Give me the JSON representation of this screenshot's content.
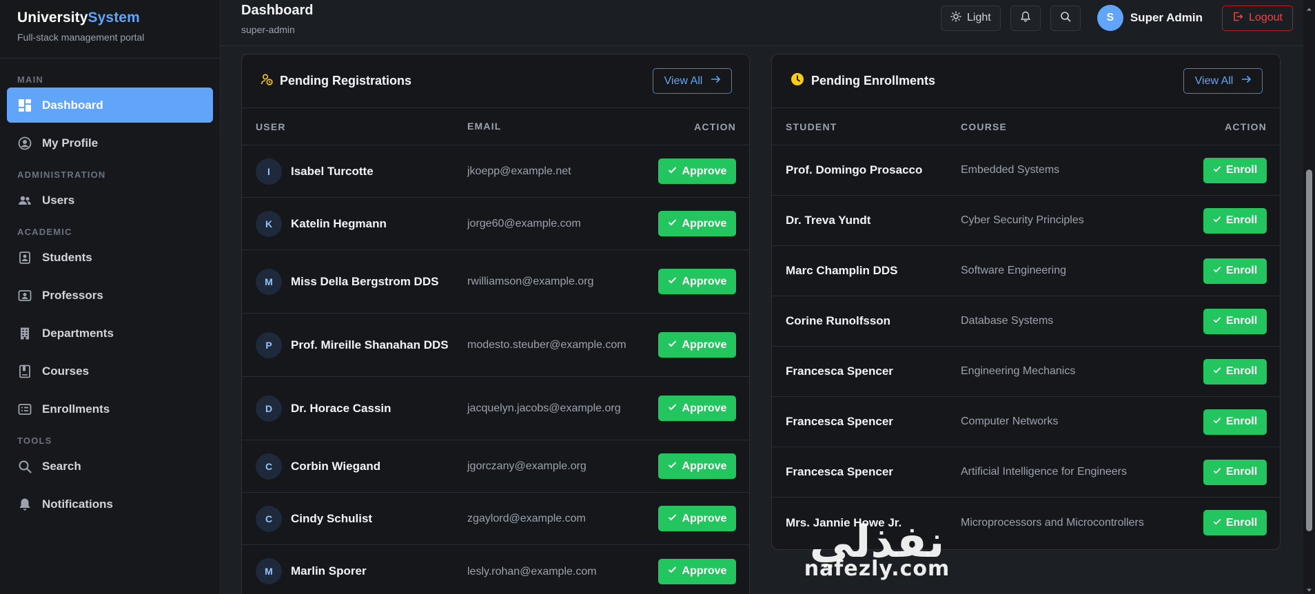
{
  "brand": {
    "title_main": "University",
    "title_accent": "System",
    "subtitle": "Full-stack management portal"
  },
  "sidebar": {
    "sections": [
      {
        "label": "MAIN",
        "items": [
          {
            "label": "Dashboard",
            "icon": "dashboard-icon",
            "active": true
          },
          {
            "label": "My Profile",
            "icon": "profile-icon"
          }
        ]
      },
      {
        "label": "ADMINISTRATION",
        "items": [
          {
            "label": "Users",
            "icon": "users-icon"
          }
        ]
      },
      {
        "label": "ACADEMIC",
        "items": [
          {
            "label": "Students",
            "icon": "students-icon"
          },
          {
            "label": "Professors",
            "icon": "professors-icon"
          },
          {
            "label": "Departments",
            "icon": "building-icon"
          },
          {
            "label": "Courses",
            "icon": "book-icon"
          },
          {
            "label": "Enrollments",
            "icon": "enrollment-icon"
          }
        ]
      },
      {
        "label": "TOOLS",
        "items": [
          {
            "label": "Search",
            "icon": "search-icon"
          },
          {
            "label": "Notifications",
            "icon": "bell-icon"
          }
        ]
      }
    ]
  },
  "header": {
    "title": "Dashboard",
    "subtitle": "super-admin",
    "theme_label": "Light",
    "user_initial": "S",
    "user_name": "Super Admin",
    "logout_label": "Logout"
  },
  "registrations": {
    "title": "Pending Registrations",
    "view_all": "View All",
    "columns": [
      "USER",
      "EMAIL",
      "ACTION"
    ],
    "approve_label": "Approve",
    "rows": [
      {
        "initial": "I",
        "name": "Isabel Turcotte",
        "email": "jkoepp@example.net"
      },
      {
        "initial": "K",
        "name": "Katelin Hegmann",
        "email": "jorge60@example.com"
      },
      {
        "initial": "M",
        "name": "Miss Della Bergstrom DDS",
        "email": "rwilliamson@example.org"
      },
      {
        "initial": "P",
        "name": "Prof. Mireille Shanahan DDS",
        "email": "modesto.steuber@example.com"
      },
      {
        "initial": "D",
        "name": "Dr. Horace Cassin",
        "email": "jacquelyn.jacobs@example.org"
      },
      {
        "initial": "C",
        "name": "Corbin Wiegand",
        "email": "jgorczany@example.org"
      },
      {
        "initial": "C",
        "name": "Cindy Schulist",
        "email": "zgaylord@example.com"
      },
      {
        "initial": "M",
        "name": "Marlin Sporer",
        "email": "lesly.rohan@example.com"
      }
    ]
  },
  "enrollments": {
    "title": "Pending Enrollments",
    "view_all": "View All",
    "columns": [
      "STUDENT",
      "COURSE",
      "ACTION"
    ],
    "enroll_label": "Enroll",
    "rows": [
      {
        "student": "Prof. Domingo Prosacco",
        "course": "Embedded Systems"
      },
      {
        "student": "Dr. Treva Yundt",
        "course": "Cyber Security Principles"
      },
      {
        "student": "Marc Champlin DDS",
        "course": "Software Engineering"
      },
      {
        "student": "Corine Runolfsson",
        "course": "Database Systems"
      },
      {
        "student": "Francesca Spencer",
        "course": "Engineering Mechanics"
      },
      {
        "student": "Francesca Spencer",
        "course": "Computer Networks"
      },
      {
        "student": "Francesca Spencer",
        "course": "Artificial Intelligence for Engineers"
      },
      {
        "student": "Mrs. Jannie Howe Jr.",
        "course": "Microprocessors and Microcontrollers"
      }
    ]
  },
  "watermark": {
    "arabic": "نفذلي",
    "latin": "nafezly.com"
  },
  "colors": {
    "accent": "#60a5fa",
    "success": "#22c55e",
    "danger": "#ef4444",
    "sidebar_bg": "#16181c",
    "card_bg": "#15171b"
  }
}
